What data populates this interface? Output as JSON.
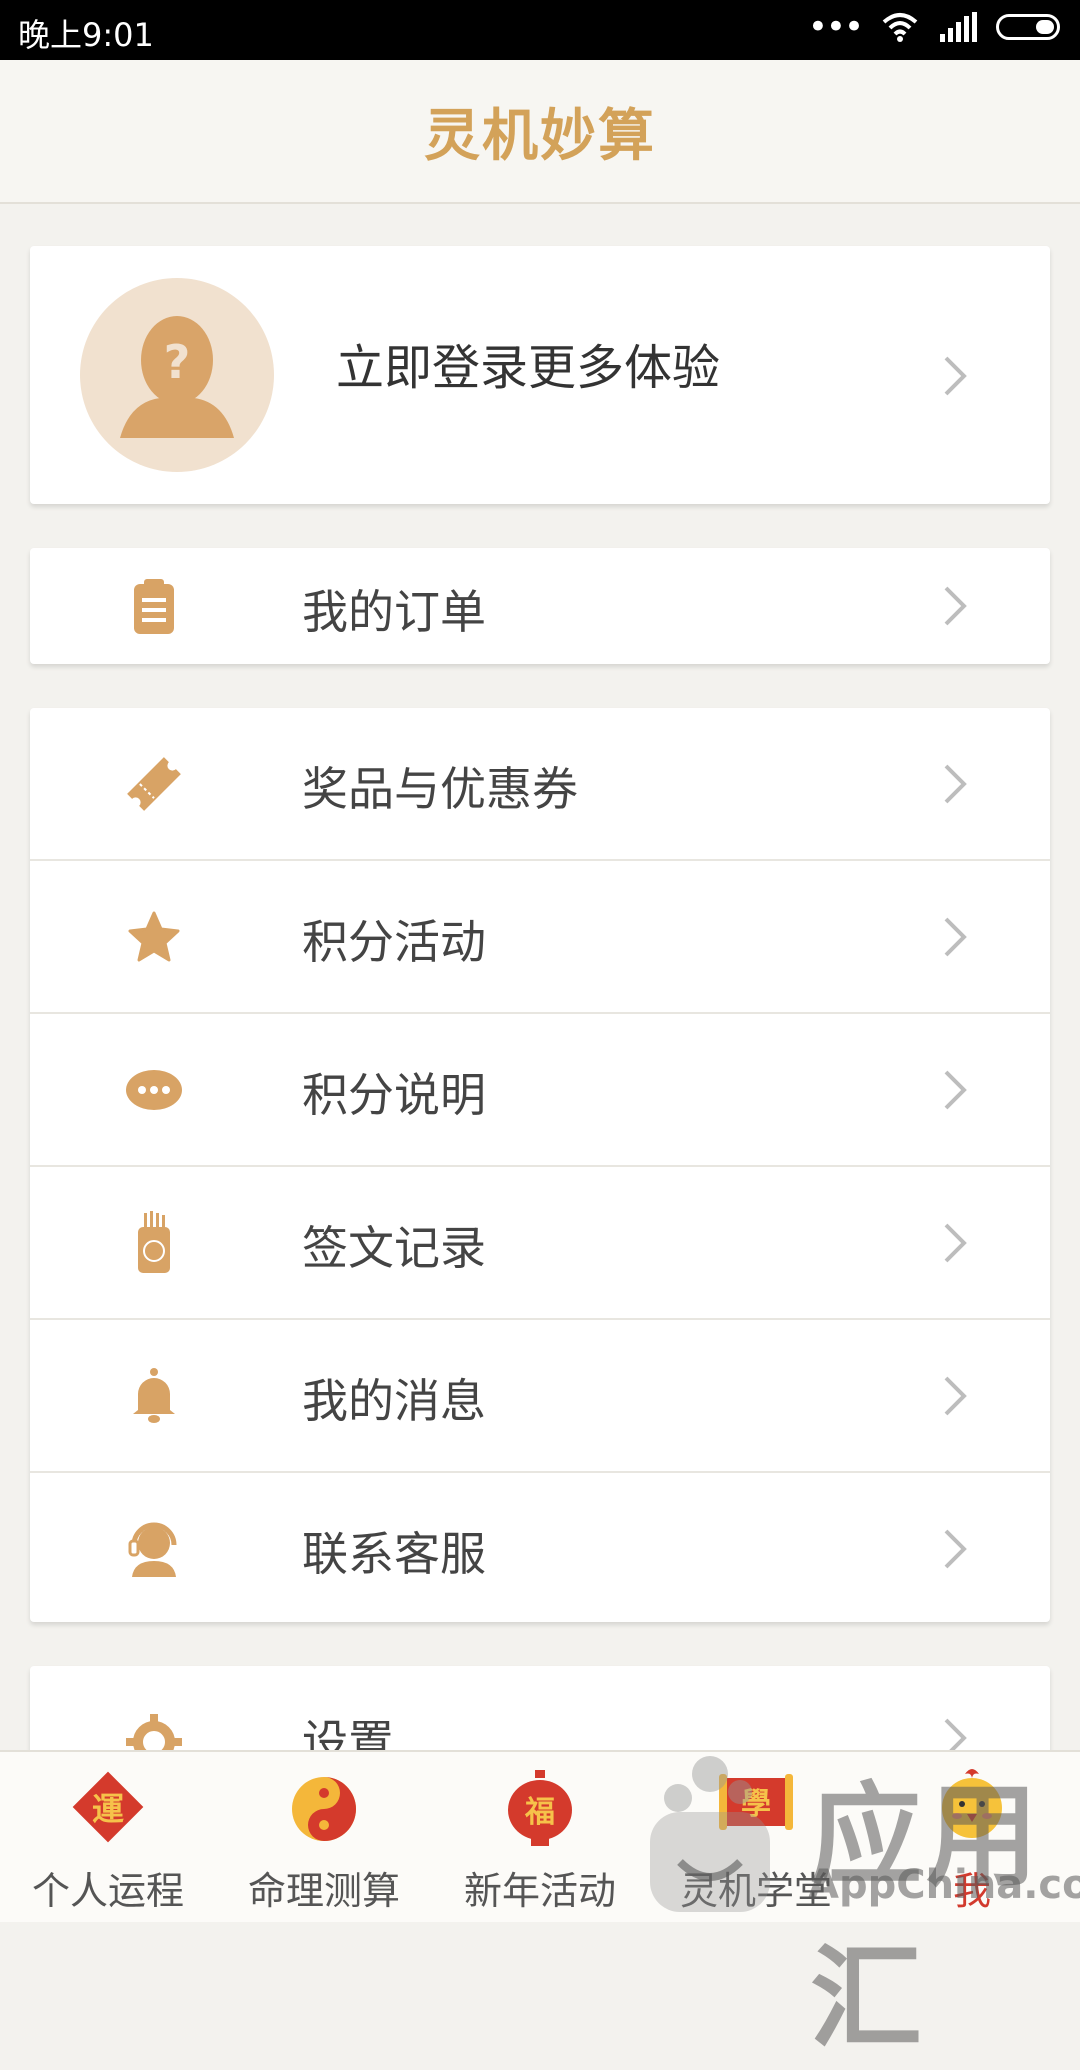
{
  "status_bar": {
    "time": "晚上9:01",
    "dots": "•••"
  },
  "header": {
    "title": "灵机妙算"
  },
  "login": {
    "text": "立即登录更多体验",
    "avatar_icon": "unknown-user-icon"
  },
  "orders": {
    "label": "我的订单",
    "icon": "clipboard-icon"
  },
  "menu": [
    {
      "label": "奖品与优惠券",
      "icon": "ticket-icon"
    },
    {
      "label": "积分活动",
      "icon": "star-icon"
    },
    {
      "label": "积分说明",
      "icon": "chat-bubble-icon"
    },
    {
      "label": "签文记录",
      "icon": "fortune-sticks-icon"
    },
    {
      "label": "我的消息",
      "icon": "bell-icon"
    },
    {
      "label": "联系客服",
      "icon": "headset-icon"
    }
  ],
  "settings": {
    "label": "设置",
    "icon": "gear-icon"
  },
  "tabs": [
    {
      "label": "个人运程",
      "icon": "fortune-diamond-icon",
      "glyph": "運"
    },
    {
      "label": "命理测算",
      "icon": "yin-yang-icon"
    },
    {
      "label": "新年活动",
      "icon": "lantern-icon",
      "glyph": "福"
    },
    {
      "label": "灵机学堂",
      "icon": "scroll-icon",
      "glyph": "學"
    },
    {
      "label": "我",
      "icon": "chick-icon",
      "active": true
    }
  ],
  "watermark": {
    "text": "应用汇",
    "sub": "AppChina.com"
  },
  "colors": {
    "accent": "#d3a259",
    "icon": "#d8a365",
    "active_tab": "#d23a2e"
  }
}
